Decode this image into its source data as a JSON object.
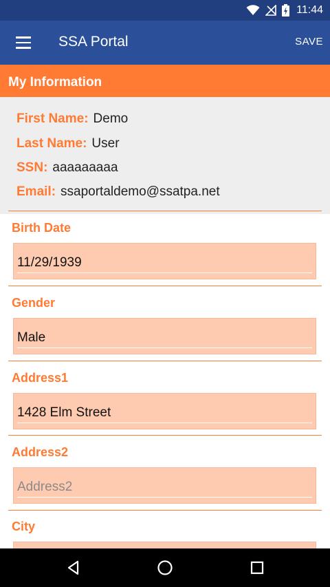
{
  "status_bar": {
    "time": "11:44"
  },
  "app_bar": {
    "title": "SSA Portal",
    "save_label": "SAVE"
  },
  "section": {
    "title": "My Information"
  },
  "info": [
    {
      "label": "First Name:",
      "value": "Demo"
    },
    {
      "label": "Last Name:",
      "value": "User"
    },
    {
      "label": "SSN:",
      "value": "aaaaaaaaa"
    },
    {
      "label": "Email:",
      "value": "ssaportaldemo@ssatpa.net"
    }
  ],
  "fields": {
    "birth_date": {
      "label": "Birth Date",
      "value": "11/29/1939"
    },
    "gender": {
      "label": "Gender",
      "value": "Male"
    },
    "address1": {
      "label": "Address1",
      "value": "1428 Elm Street"
    },
    "address2": {
      "label": "Address2",
      "placeholder": "Address2"
    },
    "city": {
      "label": "City"
    }
  },
  "colors": {
    "status_bar": "#213F7E",
    "app_bar": "#2B4F98",
    "accent": "#FF7A33",
    "field_background": "#FFCBB0",
    "info_background": "#EEEEEE"
  }
}
